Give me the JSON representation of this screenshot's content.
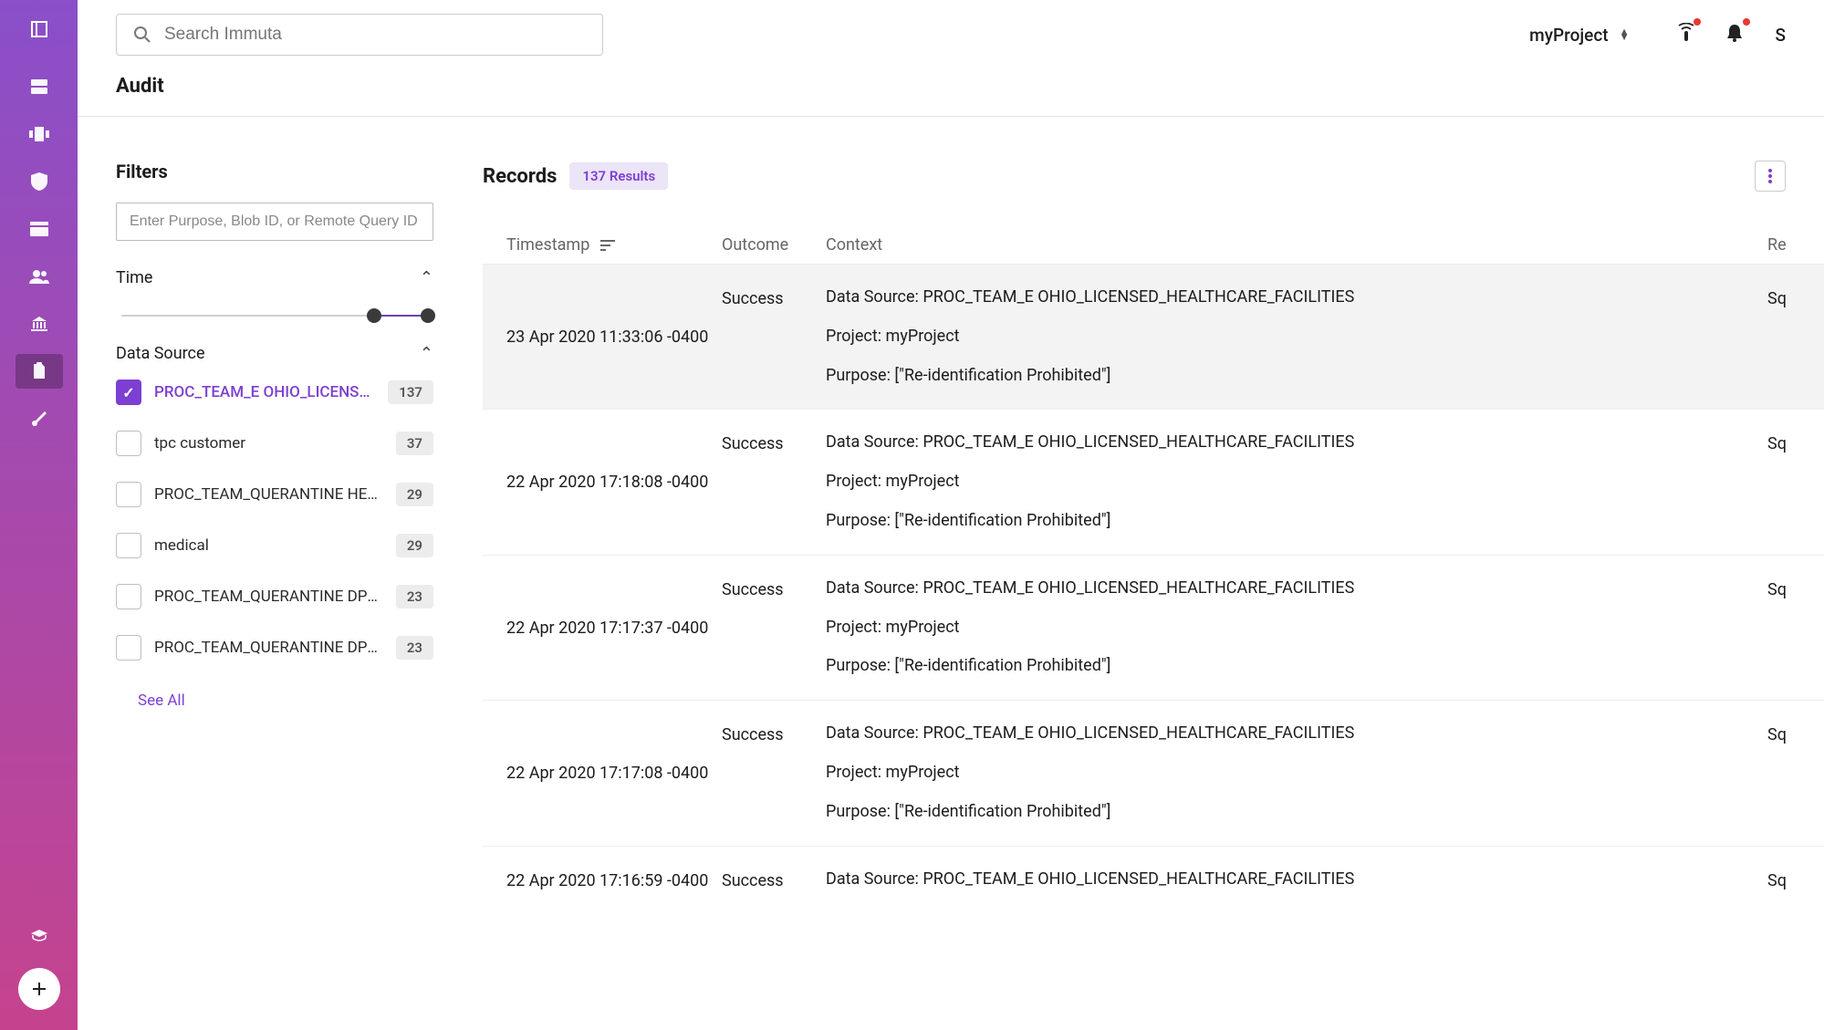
{
  "search": {
    "placeholder": "Search Immuta"
  },
  "project": {
    "name": "myProject"
  },
  "avatar": {
    "letter": "S"
  },
  "page": {
    "title": "Audit"
  },
  "filters": {
    "heading": "Filters",
    "input_placeholder": "Enter Purpose, Blob ID, or Remote Query ID",
    "time_label": "Time",
    "datasource_label": "Data Source",
    "see_all": "See All",
    "items": [
      {
        "label": "PROC_TEAM_E OHIO_LICENSED_H…",
        "count": "137",
        "checked": true
      },
      {
        "label": "tpc customer",
        "count": "37",
        "checked": false
      },
      {
        "label": "PROC_TEAM_QUERANTINE HEALTH…",
        "count": "29",
        "checked": false
      },
      {
        "label": "medical",
        "count": "29",
        "checked": false
      },
      {
        "label": "PROC_TEAM_QUERANTINE DPC_CO…",
        "count": "23",
        "checked": false
      },
      {
        "label": "PROC_TEAM_QUERANTINE DPC_CO…",
        "count": "23",
        "checked": false
      }
    ]
  },
  "records": {
    "heading": "Records",
    "results_label": "137 Results",
    "columns": {
      "ts": "Timestamp",
      "outcome": "Outcome",
      "context": "Context",
      "re": "Re"
    },
    "rows": [
      {
        "ts": "23 Apr 2020 11:33:06 -0400",
        "outcome": "Success",
        "re": "Sq",
        "ctx1": "Data Source: PROC_TEAM_E OHIO_LICENSED_HEALTHCARE_FACILITIES",
        "ctx2": "Project: myProject",
        "ctx3": "Purpose: [\"Re-identification Prohibited\"]",
        "hover": true
      },
      {
        "ts": "22 Apr 2020 17:18:08 -0400",
        "outcome": "Success",
        "re": "Sq",
        "ctx1": "Data Source: PROC_TEAM_E OHIO_LICENSED_HEALTHCARE_FACILITIES",
        "ctx2": "Project: myProject",
        "ctx3": "Purpose: [\"Re-identification Prohibited\"]"
      },
      {
        "ts": "22 Apr 2020 17:17:37 -0400",
        "outcome": "Success",
        "re": "Sq",
        "ctx1": "Data Source: PROC_TEAM_E OHIO_LICENSED_HEALTHCARE_FACILITIES",
        "ctx2": "Project: myProject",
        "ctx3": "Purpose: [\"Re-identification Prohibited\"]"
      },
      {
        "ts": "22 Apr 2020 17:17:08 -0400",
        "outcome": "Success",
        "re": "Sq",
        "ctx1": "Data Source: PROC_TEAM_E OHIO_LICENSED_HEALTHCARE_FACILITIES",
        "ctx2": "Project: myProject",
        "ctx3": "Purpose: [\"Re-identification Prohibited\"]"
      },
      {
        "ts": "22 Apr 2020 17:16:59 -0400",
        "outcome": "Success",
        "re": "Sq",
        "ctx1": "Data Source: PROC_TEAM_E OHIO_LICENSED_HEALTHCARE_FACILITIES"
      }
    ]
  }
}
